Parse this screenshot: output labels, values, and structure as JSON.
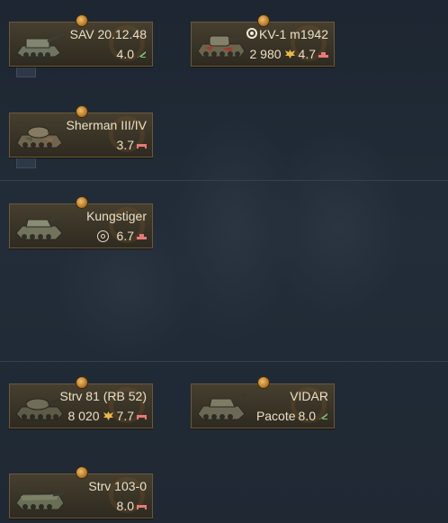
{
  "vehicles": [
    {
      "name": "SAV 20.12.48",
      "br": "4.0",
      "role": "td",
      "icon": "spg-icon",
      "camo": "#7a7d66"
    },
    {
      "name": "KV-1 m1942",
      "br": "4.7",
      "role": "heavy",
      "prefix": "target-icon",
      "cost": "2 980",
      "icon": "heavy-tank-icon",
      "camo": "#6e6a52"
    },
    {
      "name": "Sherman III/IV",
      "br": "3.7",
      "role": "medium",
      "icon": "medium-tank-icon",
      "camo": "#6f6550"
    },
    {
      "name": "Kungstiger",
      "br": "6.7",
      "role": "heavy",
      "prefix": "squadron-icon",
      "icon": "heavy-tank-icon",
      "camo": "#74745e"
    },
    {
      "name": "Strv 81 (RB 52)",
      "br": "7.7",
      "role": "medium",
      "cost": "8 020",
      "icon": "medium-tank-icon",
      "camo": "#5f5d48"
    },
    {
      "name": "VIDAR",
      "br": "8.0",
      "role": "td",
      "label_prefix": "Pacote",
      "icon": "spg-icon",
      "camo": "#6d6b56"
    },
    {
      "name": "Strv 103-0",
      "br": "8.0",
      "role": "medium",
      "icon": "medium-tank-icon",
      "camo": "#6b6f55"
    }
  ],
  "colors": {
    "role_td": "#7ec27a",
    "role_medium": "#e57a78",
    "role_heavy": "#e57a78",
    "eagle": "#e8b84a",
    "text": "#ecdfc4"
  }
}
